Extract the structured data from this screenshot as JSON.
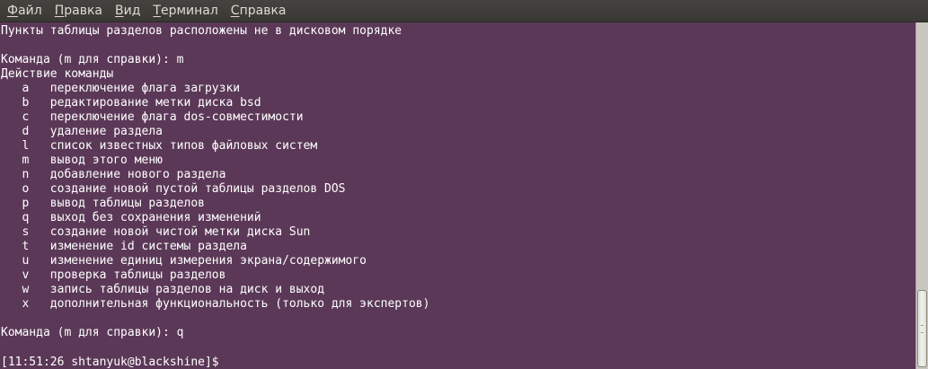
{
  "menubar": {
    "items": [
      {
        "mnemonic": "Ф",
        "rest": "айл"
      },
      {
        "mnemonic": "П",
        "rest": "равка"
      },
      {
        "mnemonic": "В",
        "rest": "ид"
      },
      {
        "mnemonic": "Т",
        "rest": "ерминал"
      },
      {
        "mnemonic": "С",
        "rest": "правка"
      }
    ]
  },
  "terminal": {
    "lines": [
      "Пункты таблицы разделов расположены не в дисковом порядке",
      "",
      "Команда (m для справки): m",
      "Действие команды",
      "   a   переключение флага загрузки",
      "   b   редактирование метки диска bsd",
      "   c   переключение флага dos-совместимости",
      "   d   удаление раздела",
      "   l   список известных типов файловых систем",
      "   m   вывод этого меню",
      "   n   добавление нового раздела",
      "   o   создание новой пустой таблицы разделов DOS",
      "   p   вывод таблицы разделов",
      "   q   выход без сохранения изменений",
      "   s   создание новой чистой метки диска Sun",
      "   t   изменение id системы раздела",
      "   u   изменение единиц измерения экрана/содержимого",
      "   v   проверка таблицы разделов",
      "   w   запись таблицы разделов на диск и выход",
      "   x   дополнительная функциональность (только для экспертов)",
      "",
      "Команда (m для справки): q",
      "",
      "[11:51:26 shtanyuk@blackshine]$"
    ]
  }
}
